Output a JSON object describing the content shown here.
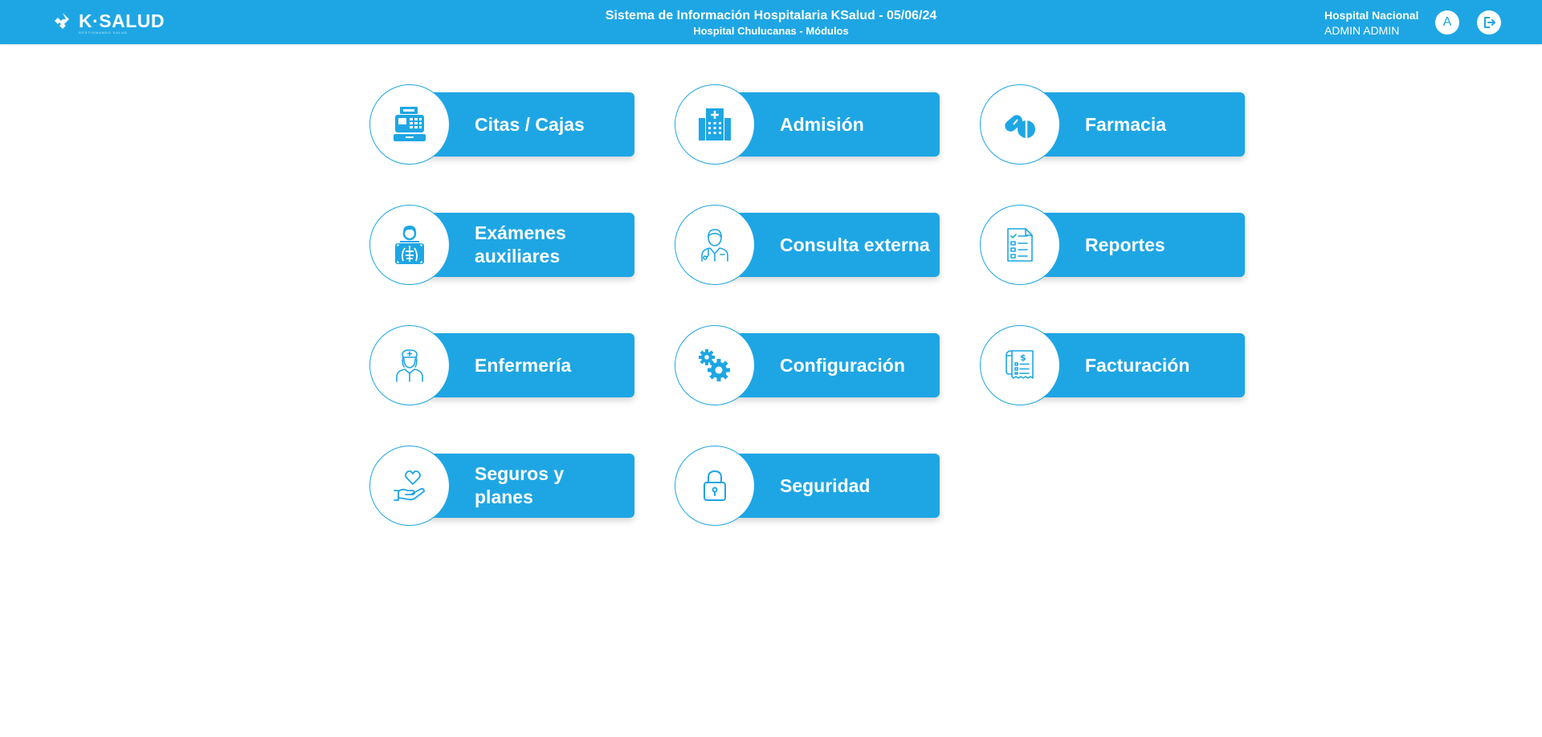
{
  "colors": {
    "brand": "#1ea6e4",
    "background": "#ffffff",
    "text_on_brand": "#ffffff"
  },
  "header": {
    "logo": "K·SALUD",
    "logo_sub": "GESTIONANDO SALUD",
    "title": "Sistema de Información Hospitalaria KSalud - 05/06/24",
    "subtitle": "Hospital Chulucanas - Módulos",
    "hospital": "Hospital Nacional",
    "user": "ADMIN ADMIN",
    "avatar_initial": "A",
    "logout_icon": "logout-icon"
  },
  "modules": [
    {
      "label": "Citas / Cajas",
      "icon": "cash-register-icon"
    },
    {
      "label": "Admisión",
      "icon": "hospital-building-icon"
    },
    {
      "label": "Farmacia",
      "icon": "pills-icon"
    },
    {
      "label": "Exámenes auxiliares",
      "icon": "xray-icon"
    },
    {
      "label": "Consulta externa",
      "icon": "doctor-icon"
    },
    {
      "label": "Reportes",
      "icon": "report-checklist-icon"
    },
    {
      "label": "Enfermería",
      "icon": "nurse-icon"
    },
    {
      "label": "Configuración",
      "icon": "gears-icon"
    },
    {
      "label": "Facturación",
      "icon": "invoice-icon"
    },
    {
      "label": "Seguros y planes",
      "icon": "heart-hand-icon"
    },
    {
      "label": "Seguridad",
      "icon": "padlock-icon"
    }
  ]
}
